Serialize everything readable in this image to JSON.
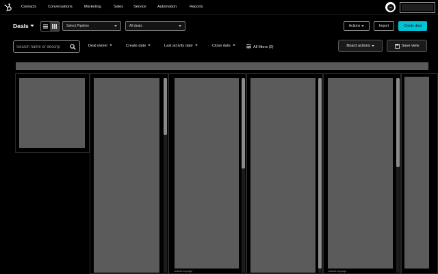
{
  "topnav": {
    "logo_icon": "hubspot-sprocket-icon",
    "items": [
      "Contacts",
      "Conversations",
      "Marketing",
      "Sales",
      "Service",
      "Automation",
      "Reports"
    ],
    "avatar_initials": "ot"
  },
  "toolbar": {
    "title": "Deals",
    "pipeline_select": "Select Pipeline",
    "deals_select": "All deals",
    "actions_label": "Actions",
    "import_label": "Import",
    "create_label": "Create deal"
  },
  "filters": {
    "search_placeholder": "Search name or descrip",
    "deal_owner": "Deal owner",
    "create_date": "Create date",
    "last_activity_date": "Last activity date",
    "close_date": "Close date",
    "all_filters": "All filters (0)",
    "board_actions": "Board actions",
    "save_view": "Save view"
  },
  "board": {
    "column_footers": [
      "rwdwe8 seppags",
      "rwdwe8 seppags"
    ]
  },
  "colors": {
    "accent": "#00c3d4",
    "card": "#5b5b5b",
    "background": "#000000"
  }
}
